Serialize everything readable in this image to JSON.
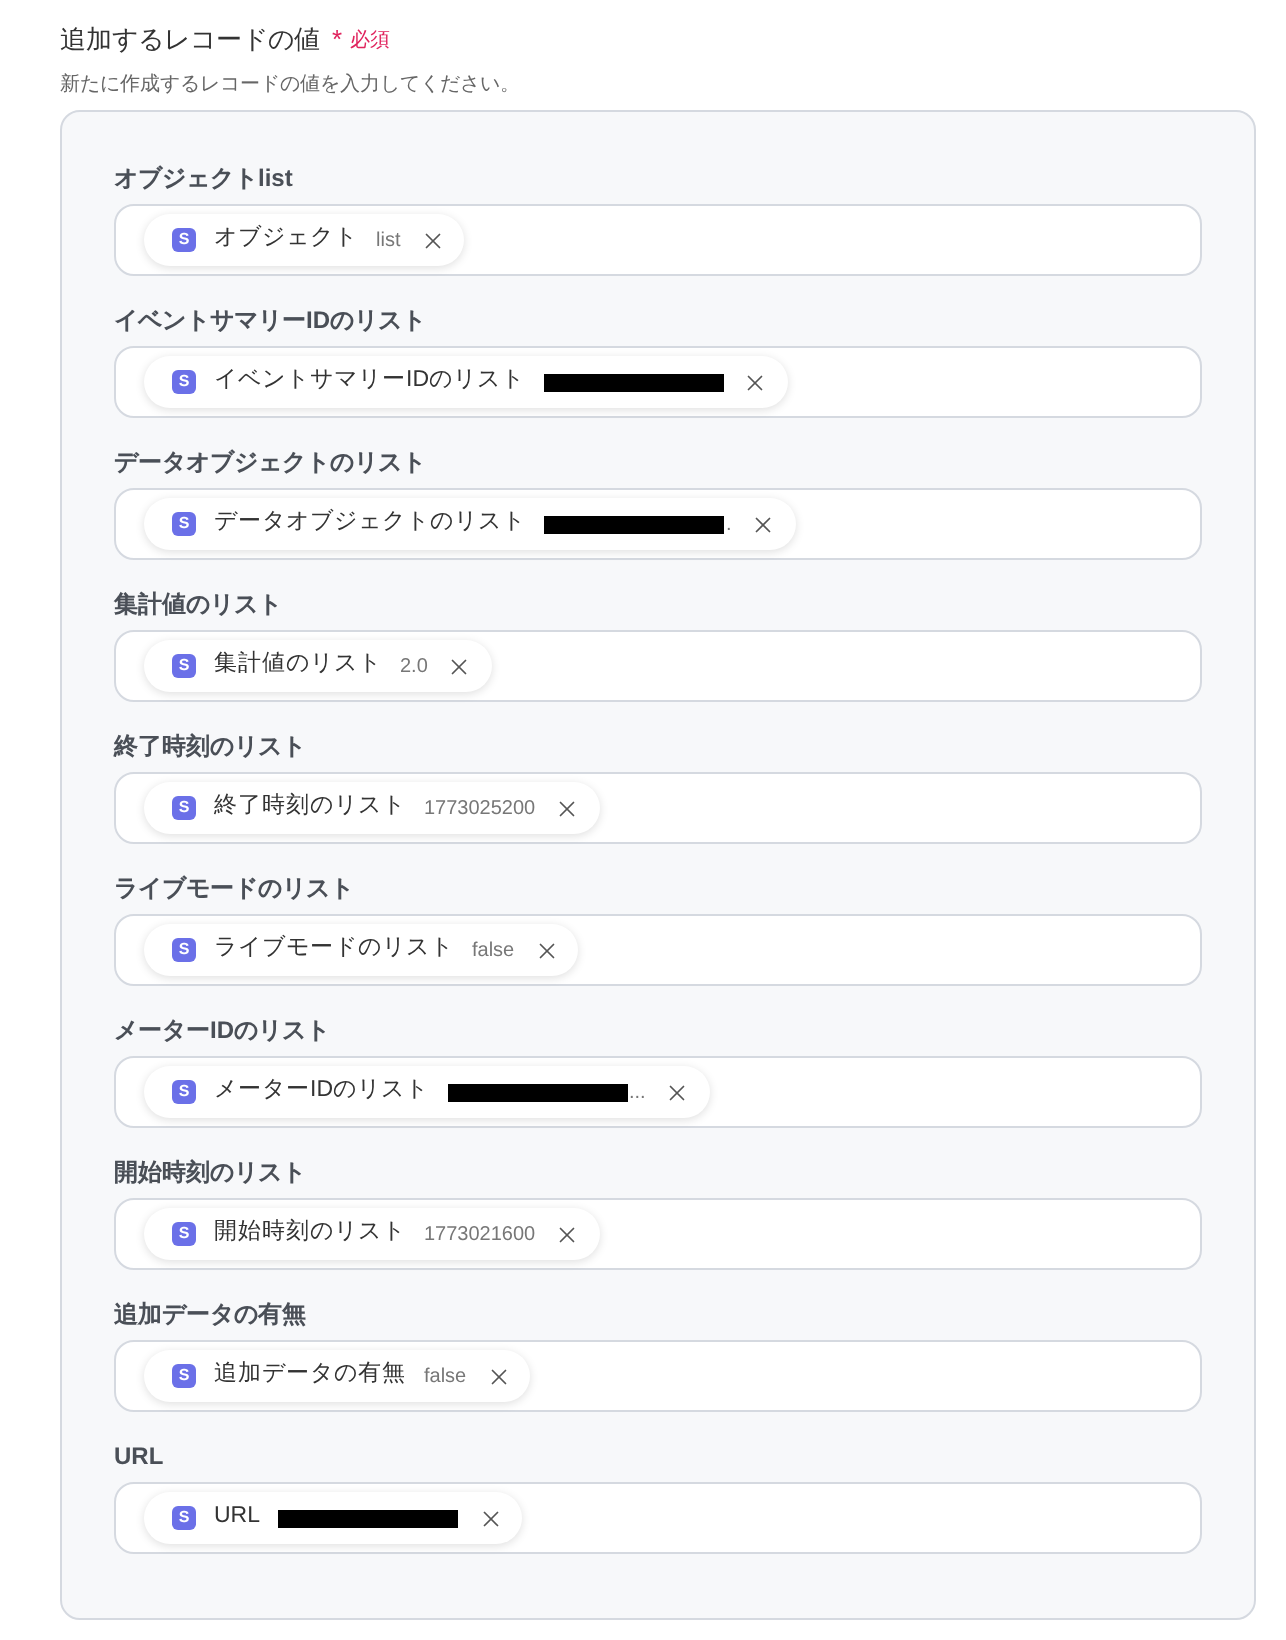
{
  "section": {
    "title": "追加するレコードの値",
    "required": {
      "mark": "*",
      "label": "必須"
    },
    "description": "新たに作成するレコードの値を入力してください。"
  },
  "fields": [
    {
      "label": "オブジェクトlist",
      "tags": [
        {
          "icon_letter": "S",
          "name": "オブジェクト",
          "value": "list",
          "redacted": false
        }
      ]
    },
    {
      "label": "イベントサマリーIDのリスト",
      "tags": [
        {
          "icon_letter": "S",
          "name": "イベントサマリーIDのリスト",
          "redacted": true
        }
      ]
    },
    {
      "label": "データオブジェクトのリスト",
      "tags": [
        {
          "icon_letter": "S",
          "name": "データオブジェクトのリスト",
          "value": ".",
          "redacted": true
        }
      ]
    },
    {
      "label": "集計値のリスト",
      "tags": [
        {
          "icon_letter": "S",
          "name": "集計値のリスト",
          "value": "2.0",
          "redacted": false
        }
      ]
    },
    {
      "label": "終了時刻のリスト",
      "tags": [
        {
          "icon_letter": "S",
          "name": "終了時刻のリスト",
          "value": "1773025200",
          "redacted": false
        }
      ]
    },
    {
      "label": "ライブモードのリスト",
      "tags": [
        {
          "icon_letter": "S",
          "name": "ライブモードのリスト",
          "value": "false",
          "redacted": false
        }
      ]
    },
    {
      "label": "メーターIDのリスト",
      "tags": [
        {
          "icon_letter": "S",
          "name": "メーターIDのリスト",
          "value": "...",
          "redacted": true
        }
      ]
    },
    {
      "label": "開始時刻のリスト",
      "tags": [
        {
          "icon_letter": "S",
          "name": "開始時刻のリスト",
          "value": "1773021600",
          "redacted": false
        }
      ]
    },
    {
      "label": "追加データの有無",
      "tags": [
        {
          "icon_letter": "S",
          "name": "追加データの有無",
          "value": "false",
          "redacted": false
        }
      ]
    },
    {
      "label": "URL",
      "tags": [
        {
          "icon_letter": "S",
          "name": "URL",
          "redacted": true
        }
      ]
    }
  ]
}
